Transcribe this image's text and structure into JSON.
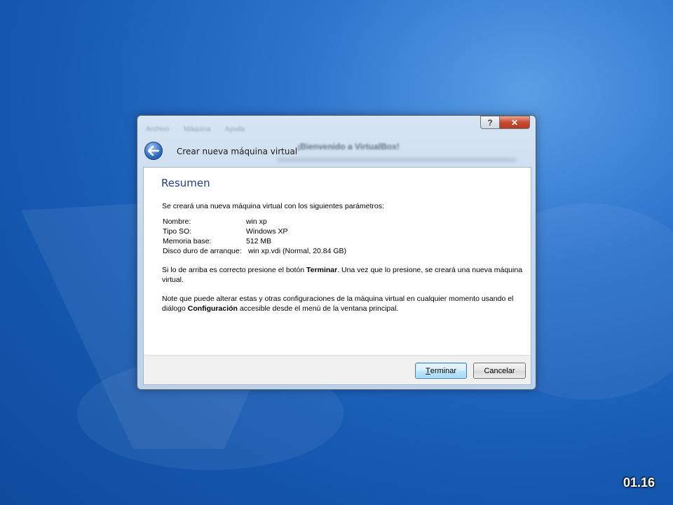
{
  "wizard": {
    "title": "Crear nueva máquina virtual",
    "help_label": "?",
    "close_label": "✕",
    "background_window": {
      "menu": [
        "Archivo",
        "Máquina",
        "Ayuda"
      ],
      "welcome": "¡Bienvenido a VirtualBox!"
    }
  },
  "summary": {
    "heading": "Resumen",
    "intro": "Se creará una nueva máquina virtual con los siguientes parámetros:",
    "params": [
      {
        "key": "Nombre:",
        "value": "win xp"
      },
      {
        "key": "Tipo SO:",
        "value": "Windows XP"
      },
      {
        "key": "Memoria base:",
        "value": "512 MB"
      },
      {
        "key": "Disco duro de arranque:",
        "value": "win xp.vdi (Normal, 20.84 GB)"
      }
    ],
    "confirm": {
      "before": "Si lo de arriba es correcto presione el botón ",
      "bold": "Terminar",
      "after": ". Una vez que lo presione, se creará una nueva máquina virtual."
    },
    "note": {
      "before": "Note que puede alterar estas y otras configuraciones de la máquina virtual en cualquier momento usando el diálogo ",
      "bold": "Configuración",
      "after": " accesible desde el menú de la ventana principal."
    }
  },
  "buttons": {
    "finish_mnemonic": "T",
    "finish_rest": "erminar",
    "cancel": "Cancelar"
  },
  "slide_number": "01.16",
  "colors": {
    "desktop_blue": "#175bb4",
    "heading_blue": "#1e3f8a",
    "close_red": "#c8492e"
  }
}
